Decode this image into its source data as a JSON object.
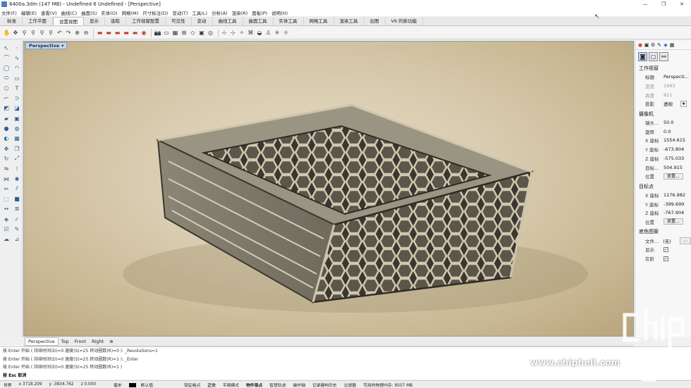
{
  "window": {
    "title": "6400a.3dm (147 MB) - Undefined 6 Undefined - [Perspective]",
    "min": "—",
    "max": "❐",
    "close": "✕"
  },
  "menu": [
    "文件(F)",
    "编辑(E)",
    "查看(V)",
    "曲线(C)",
    "曲面(S)",
    "实体(O)",
    "网格(M)",
    "尺寸标注(D)",
    "变动(T)",
    "工具(L)",
    "分析(A)",
    "渲染(R)",
    "面板(P)",
    "说明(H)"
  ],
  "tabs": [
    {
      "label": "标准",
      "active": false
    },
    {
      "label": "工作平面",
      "active": false
    },
    {
      "label": "设置视图",
      "active": true
    },
    {
      "label": "显示",
      "active": false
    },
    {
      "label": "选取",
      "active": false
    },
    {
      "label": "工作视窗配置",
      "active": false
    },
    {
      "label": "可见性",
      "active": false
    },
    {
      "label": "变动",
      "active": false
    },
    {
      "label": "曲线工具",
      "active": false
    },
    {
      "label": "曲面工具",
      "active": false
    },
    {
      "label": "实体工具",
      "active": false
    },
    {
      "label": "网格工具",
      "active": false
    },
    {
      "label": "渲染工具",
      "active": false
    },
    {
      "label": "出图",
      "active": false
    },
    {
      "label": "V6 的新功能",
      "active": false
    }
  ],
  "toolbar_icons": [
    "pan-icon",
    "rotate-icon",
    "zoom-icon",
    "zoom-window-icon",
    "zoom-extents-icon",
    "zoom-selected-icon",
    "undo-view-icon",
    "redo-view-icon",
    "zoom-in-icon",
    "zoom-out-icon",
    "car-icon",
    "car-icon",
    "car-icon",
    "car-icon",
    "car-icon",
    "shade-icon",
    "camera-icon",
    "viewport-icon",
    "grid-icon",
    "layout-icon",
    "plane-icon",
    "cube-icon",
    "target-icon",
    "cross-icon",
    "snap-icon",
    "light-icon",
    "render-icon",
    "eye-icon",
    "walk-icon",
    "star-icon",
    "sun-icon"
  ],
  "left_tools": [
    "select-icon",
    "point-icon",
    "polyline-icon",
    "curve-icon",
    "circle-icon",
    "arc-icon",
    "ellipse-icon",
    "rect-icon",
    "polygon-icon",
    "text-icon",
    "fillet-icon",
    "offset-icon",
    "surface-icon",
    "loft-icon",
    "extrude-icon",
    "box-icon",
    "sphere-icon",
    "cylinder-icon",
    "boolean-icon",
    "mesh-icon",
    "move-icon",
    "copy-icon",
    "rotate-tool-icon",
    "scale-icon",
    "mirror-icon",
    "array-icon",
    "join-icon",
    "explode-icon",
    "trim-icon",
    "split-icon",
    "group-icon",
    "block-icon",
    "dimension-icon",
    "layer-icon",
    "render-tool-icon",
    "analyze-icon",
    "check-icon",
    "pencil-icon",
    "blend-icon",
    "cap-icon"
  ],
  "viewport": {
    "label": "Perspective"
  },
  "panel": {
    "tab_icons": [
      "●",
      "▣",
      "⚙",
      "✎",
      "◆",
      "▦"
    ],
    "section_viewport": "工作视窗",
    "rows_viewport": [
      {
        "k": "标题",
        "v": "Perspecti..."
      },
      {
        "k": "宽度",
        "v": "1693",
        "dim": true
      },
      {
        "k": "高度",
        "v": "821",
        "dim": true
      },
      {
        "k": "投影",
        "v": "透视"
      }
    ],
    "section_camera": "摄像机",
    "rows_camera": [
      {
        "k": "镜头...",
        "v": "50.0"
      },
      {
        "k": "旋转",
        "v": "0.0"
      },
      {
        "k": "X 座标",
        "v": "1554.615"
      },
      {
        "k": "Y 座标",
        "v": "-673.804"
      },
      {
        "k": "Z 座标",
        "v": "-575.033"
      },
      {
        "k": "目标...",
        "v": "504.915"
      },
      {
        "k": "位置",
        "btn": "放置..."
      }
    ],
    "section_target": "目标点",
    "rows_target": [
      {
        "k": "X 座标",
        "v": "1176.982"
      },
      {
        "k": "Y 座标",
        "v": "-399.699"
      },
      {
        "k": "Z 座标",
        "v": "-767.904"
      },
      {
        "k": "位置",
        "btn": "放置..."
      }
    ],
    "section_bg": "底色图案",
    "rows_bg": [
      {
        "k": "文件...",
        "v": "(无)"
      },
      {
        "k": "显示",
        "check": "✓"
      },
      {
        "k": "灰阶",
        "check": "✓"
      }
    ],
    "more_btn": "..."
  },
  "viewport_tabs": [
    {
      "label": "Perspective",
      "active": true
    },
    {
      "label": "Top",
      "active": false
    },
    {
      "label": "Front",
      "active": false
    },
    {
      "label": "Right",
      "active": false
    },
    {
      "label": "⊕",
      "active": false
    }
  ],
  "command_lines": [
    "按 Enter 开始 ( 持续时间(D)=0  速度(S)=25  转动圈数(R)=0 ): _Revolutions=1",
    "按 Enter 开始 ( 持续时间(D)=0  速度(S)=25  转动圈数(R)=1 ): _Enter",
    "按 Enter 开始 ( 持续时间(D)=0  速度(S)=25  转动圈数(R)=1 )"
  ],
  "command_prompt": "按 Esc 取消",
  "status": {
    "cplane": "世界",
    "x": "x 3718.209",
    "y": "y -3834.762",
    "z": "z 0.000",
    "units": "毫米",
    "layer": "默认值",
    "toggles": [
      "锁定格点",
      "正交",
      "平面模式",
      "物件锁点",
      "智慧轨迹",
      "操作轴",
      "记录建构历史",
      "过滤器"
    ],
    "memory": "可用的物理内存: 9507 MB"
  },
  "watermark": {
    "site": "www.chiphell.com",
    "logo_text": "chip hell"
  }
}
